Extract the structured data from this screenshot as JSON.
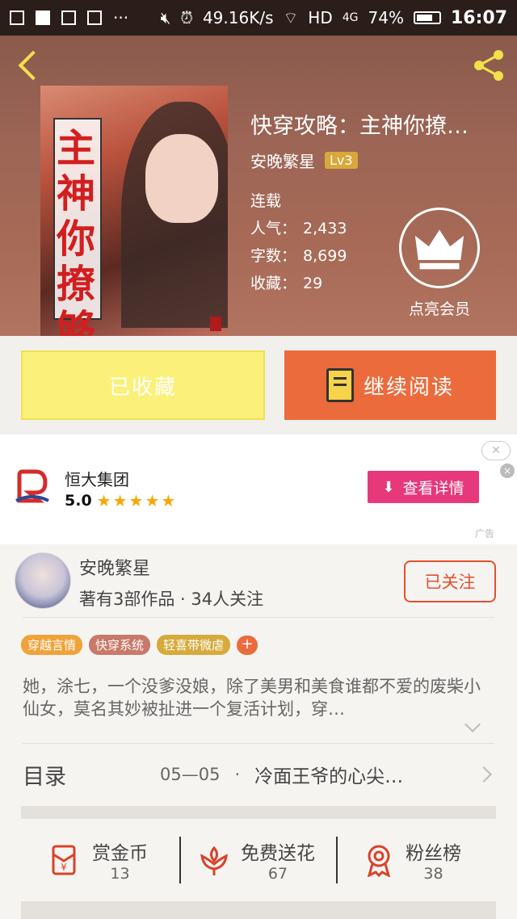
{
  "status_bar": {
    "speed": "49.16K/s",
    "network": "HD",
    "signal": "4G",
    "battery": "74%",
    "battery_level": 0.74,
    "time": "16:07"
  },
  "book": {
    "title": "快穿攻略：主神你撩…",
    "author": "安晚繁星",
    "level": "Lv3",
    "status": "连载",
    "popularity_label": "人气：",
    "popularity": "2,433",
    "words_label": "字数：",
    "words": "8,699",
    "collect_label": "收藏：",
    "collect": "29",
    "cover_text": "主神你撩够了没"
  },
  "vip": {
    "label": "点亮会员"
  },
  "buttons": {
    "favorite": "已收藏",
    "read": "继续阅读"
  },
  "ad": {
    "company": "恒大集团",
    "rating": "5.0",
    "stars": "★★★★★",
    "cta": "查看详情",
    "close": "✕",
    "x": "×",
    "tag": "广告"
  },
  "author_card": {
    "name": "安晚繁星",
    "meta": "著有3部作品 · 34人关注",
    "follow": "已关注",
    "tags": [
      "穿越言情",
      "快穿系统",
      "轻喜带微虐"
    ],
    "tag_plus": "+",
    "intro": "她，涂七，一个没爹没娘，除了美男和美食谁都不爱的废柴小仙女，莫名其妙被扯进一个复活计划，穿…"
  },
  "toc": {
    "label": "目录",
    "date": "05—05",
    "dot": "·",
    "chapter": "冷面王爷的心尖…"
  },
  "actions": [
    {
      "label": "赏金币",
      "count": "13",
      "icon": "red-envelope-icon"
    },
    {
      "label": "免费送花",
      "count": "67",
      "icon": "flower-icon"
    },
    {
      "label": "粉丝榜",
      "count": "38",
      "icon": "medal-icon"
    }
  ],
  "colors": {
    "accent_orange": "#ec6b3c",
    "accent_red": "#e2502e",
    "fav_yellow": "#fbf07a",
    "ad_pink": "#e6387b",
    "header_brown": "#9c6555"
  }
}
